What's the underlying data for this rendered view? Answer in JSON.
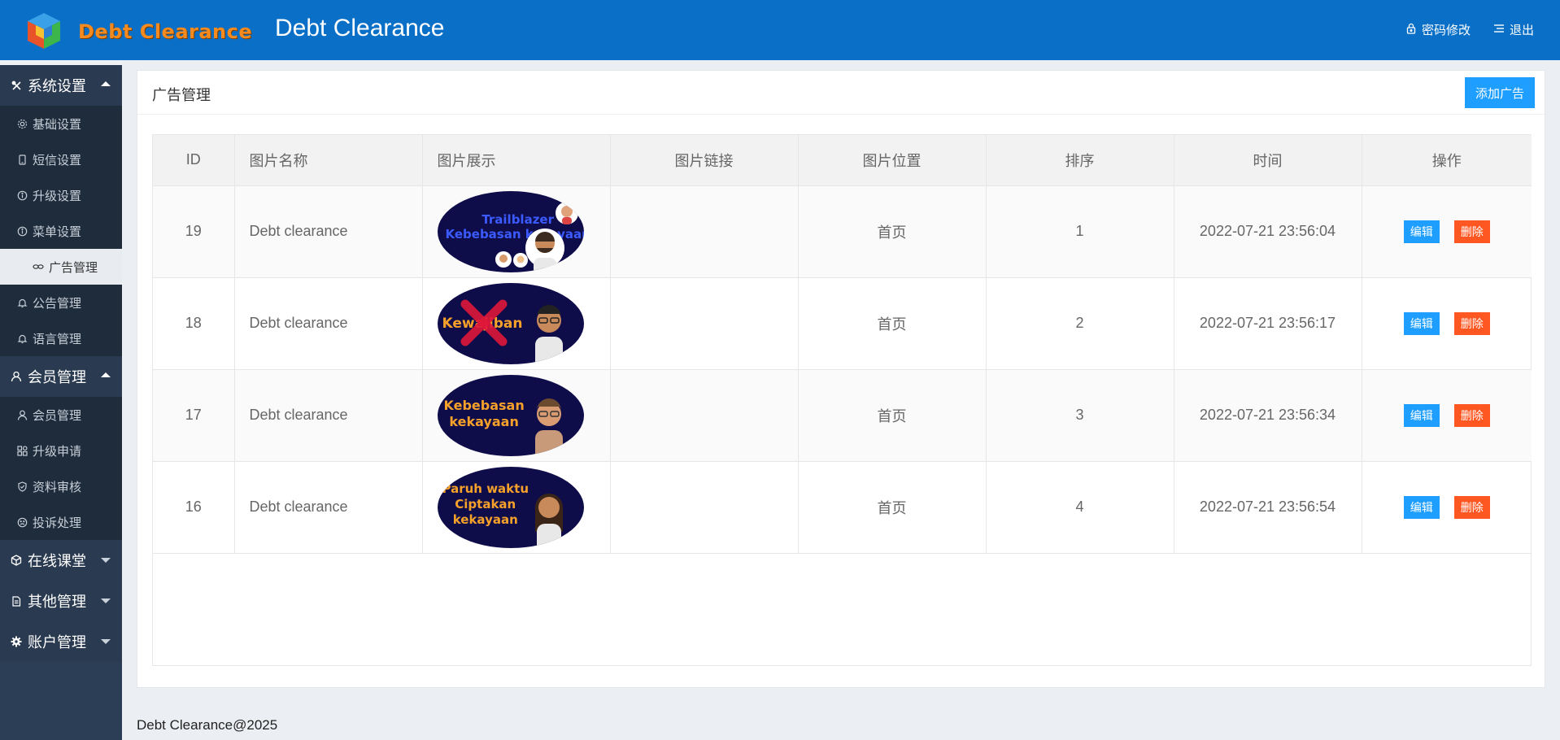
{
  "header": {
    "logo_text": "Debt Clearance",
    "title": "Debt Clearance",
    "actions": [
      {
        "label": "密码修改",
        "icon": "lock-icon"
      },
      {
        "label": "退出",
        "icon": "logout-icon"
      }
    ]
  },
  "sidebar": {
    "groups": [
      {
        "label": "系统设置",
        "icon": "tools-icon",
        "expanded": true,
        "items": [
          {
            "label": "基础设置",
            "icon": "gear-icon"
          },
          {
            "label": "短信设置",
            "icon": "phone-icon"
          },
          {
            "label": "升级设置",
            "icon": "info-icon"
          },
          {
            "label": "菜单设置",
            "icon": "info-icon"
          },
          {
            "label": "广告管理",
            "icon": "link-icon",
            "active": true
          },
          {
            "label": "公告管理",
            "icon": "bell-icon"
          },
          {
            "label": "语言管理",
            "icon": "bell-icon"
          }
        ]
      },
      {
        "label": "会员管理",
        "icon": "user-icon",
        "expanded": true,
        "items": [
          {
            "label": "会员管理",
            "icon": "user-icon"
          },
          {
            "label": "升级申请",
            "icon": "apps-icon"
          },
          {
            "label": "资料审核",
            "icon": "shield-check-icon"
          },
          {
            "label": "投诉处理",
            "icon": "face-icon"
          }
        ]
      },
      {
        "label": "在线课堂",
        "icon": "cube-icon",
        "expanded": false
      },
      {
        "label": "其他管理",
        "icon": "file-icon",
        "expanded": false
      },
      {
        "label": "账户管理",
        "icon": "cog-icon",
        "expanded": false
      }
    ]
  },
  "main": {
    "title": "广告管理",
    "add_button": "添加广告",
    "columns": [
      "ID",
      "图片名称",
      "图片展示",
      "图片链接",
      "图片位置",
      "排序",
      "时间",
      "操作"
    ],
    "rows": [
      {
        "id": "19",
        "name": "Debt clearance",
        "image_text": "Trailblazer\nKebebasan kekayaan",
        "link": "",
        "position": "首页",
        "sort": "1",
        "time": "2022-07-21 23:56:04"
      },
      {
        "id": "18",
        "name": "Debt clearance",
        "image_text": "Kewajiban",
        "link": "",
        "position": "首页",
        "sort": "2",
        "time": "2022-07-21 23:56:17"
      },
      {
        "id": "17",
        "name": "Debt clearance",
        "image_text": "Kebebasan\nkekayaan",
        "link": "",
        "position": "首页",
        "sort": "3",
        "time": "2022-07-21 23:56:34"
      },
      {
        "id": "16",
        "name": "Debt clearance",
        "image_text": "Paruh waktu\nCiptakan\nkekayaan",
        "link": "",
        "position": "首页",
        "sort": "4",
        "time": "2022-07-21 23:56:54"
      }
    ],
    "edit_label": "编辑",
    "delete_label": "删除"
  },
  "footer": {
    "text": "Debt Clearance@2025"
  },
  "colors": {
    "header": "#0a6fc7",
    "primary": "#1e9fff",
    "danger": "#ff5722",
    "sidebar": "#2c3e55"
  }
}
